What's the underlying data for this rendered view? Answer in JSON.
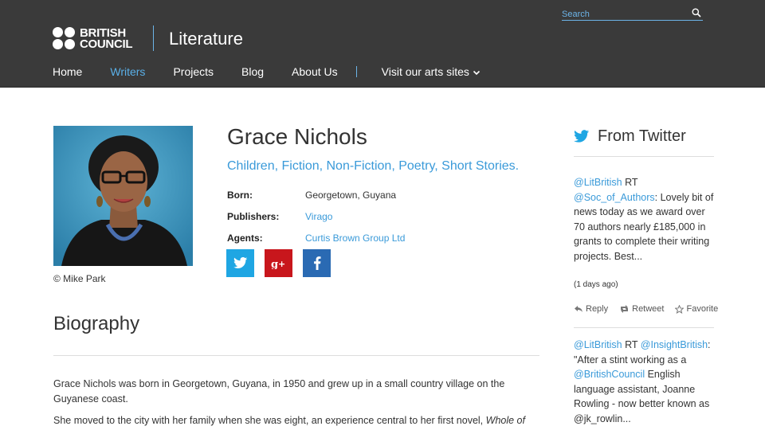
{
  "header": {
    "logo_line1": "BRITISH",
    "logo_line2": "COUNCIL",
    "site_title": "Literature",
    "search_placeholder": "Search",
    "nav": [
      {
        "label": "Home"
      },
      {
        "label": "Writers"
      },
      {
        "label": "Projects"
      },
      {
        "label": "Blog"
      },
      {
        "label": "About Us"
      },
      {
        "label": "Visit our arts sites"
      }
    ]
  },
  "author": {
    "name": "Grace Nichols",
    "genres": [
      "Children",
      "Fiction",
      "Non-Fiction",
      "Poetry",
      "Short Stories"
    ],
    "facts": [
      {
        "label": "Born:",
        "value": "Georgetown, Guyana"
      },
      {
        "label": "Publishers:",
        "value": "Virago"
      },
      {
        "label": "Agents:",
        "value": "Curtis Brown Group Ltd"
      }
    ],
    "photo_caption": "© Mike Park"
  },
  "biography": {
    "heading": "Biography",
    "p1": "Grace Nichols was born in Georgetown, Guyana, in 1950 and grew up in a small country village on the Guyanese coast.",
    "p2_start": "She moved to the city with her family when she was eight, an experience central to her first novel, ",
    "p2_italic": "Whole of"
  },
  "twitter": {
    "heading": "From Twitter",
    "tweet1": {
      "user": "@LitBritish",
      "rt": " RT ",
      "mention": "@Soc_of_Authors",
      "text": ": Lovely bit of news today as we award over 70 authors nearly £185,000 in grants to complete their writing projects. Best...",
      "time": "(1 days ago)"
    },
    "actions": {
      "reply": "Reply",
      "retweet": "Retweet",
      "favorite": "Favorite"
    },
    "tweet2": {
      "user": "@LitBritish",
      "rt": " RT ",
      "mention": "@InsightBritish",
      "text_a": ": \"After a stint working as a ",
      "mention2": "@BritishCouncil",
      "text_b": " English language assistant, Joanne Rowling - now better known as @jk_rowlin..."
    }
  },
  "colors": {
    "header_bg": "#3a3a3a",
    "accent_blue": "#3a9ad9",
    "twitter_blue": "#1fa6e3",
    "google_red": "#c8161c",
    "facebook_blue": "#2a6ab3"
  }
}
